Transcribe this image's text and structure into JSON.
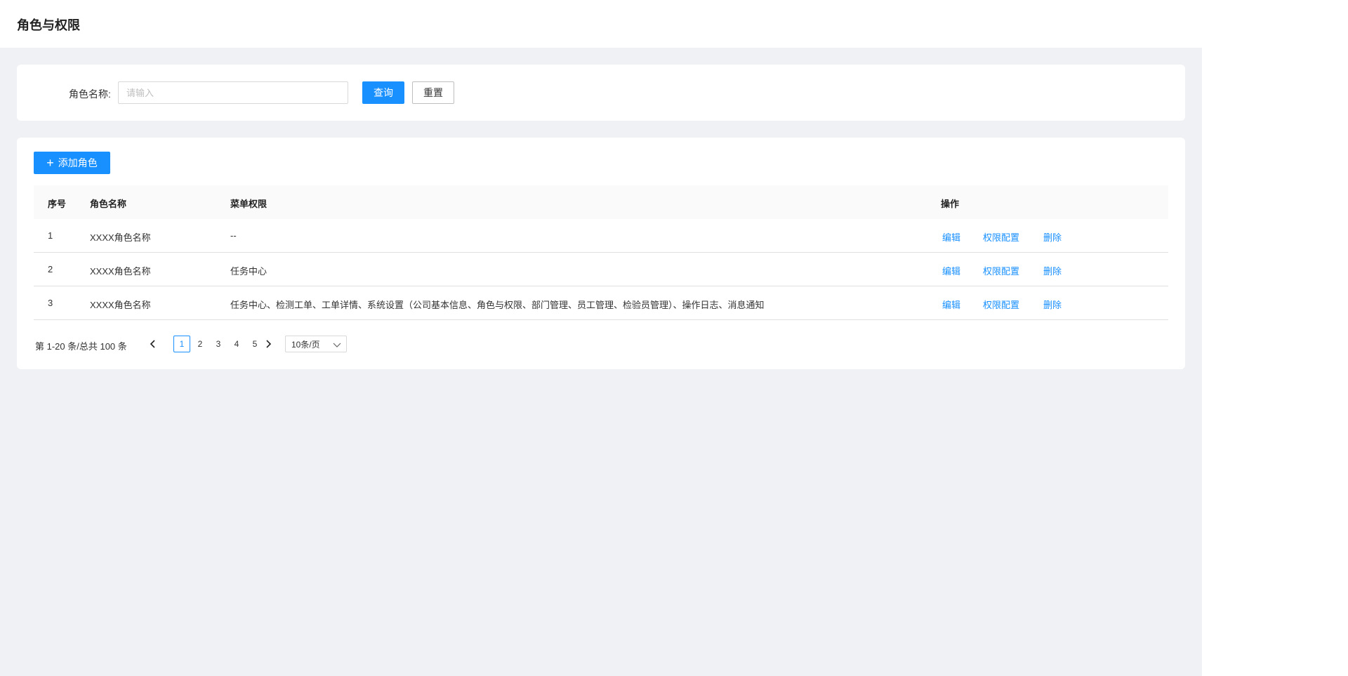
{
  "header": {
    "title": "角色与权限"
  },
  "search": {
    "label": "角色名称:",
    "placeholder": "请输入",
    "value": "",
    "query_label": "查询",
    "reset_label": "重置"
  },
  "toolbar": {
    "add_label": "添加角色"
  },
  "table": {
    "columns": [
      "序号",
      "角色名称",
      "菜单权限",
      "操作"
    ],
    "rows": [
      {
        "index": "1",
        "name": "XXXX角色名称",
        "menu": "--"
      },
      {
        "index": "2",
        "name": "XXXX角色名称",
        "menu": "任务中心"
      },
      {
        "index": "3",
        "name": "XXXX角色名称",
        "menu": "任务中心、检测工单、工单详情、系统设置（公司基本信息、角色与权限、部门管理、员工管理、检验员管理）、操作日志、消息通知"
      }
    ],
    "actions": {
      "edit": "编辑",
      "permission": "权限配置",
      "delete": "删除"
    }
  },
  "pagination": {
    "total_text": "第 1-20 条/总共 100 条",
    "pages": [
      "1",
      "2",
      "3",
      "4",
      "5"
    ],
    "current": "1",
    "page_size": "10条/页"
  },
  "colors": {
    "primary": "#1890ff",
    "background": "#f0f1f4"
  }
}
